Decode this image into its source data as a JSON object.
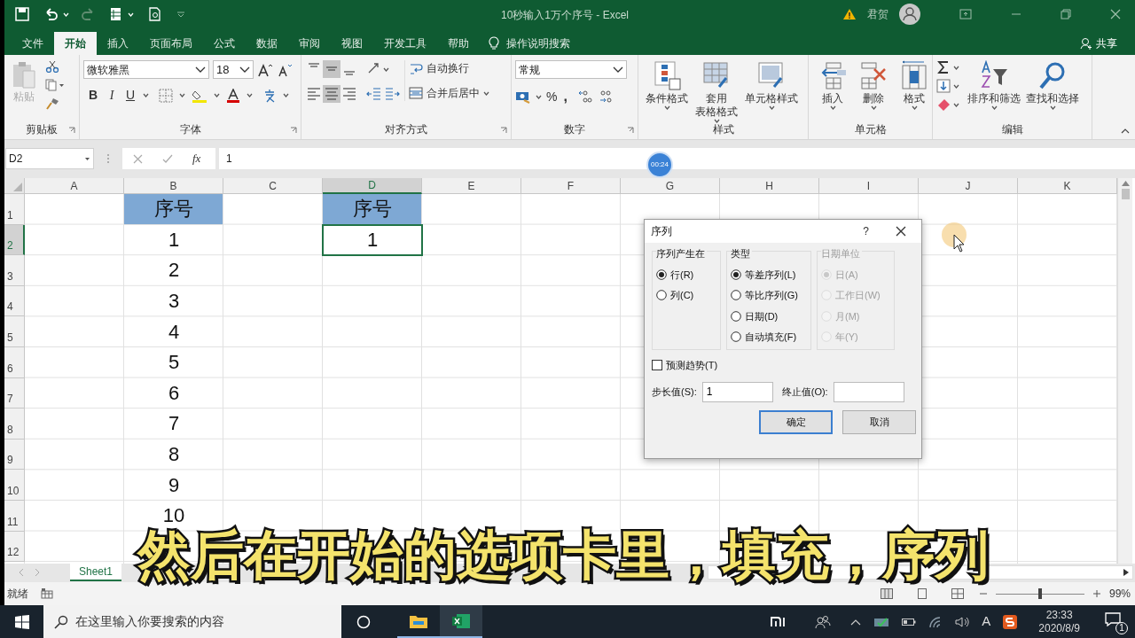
{
  "title_bar": {
    "title": "10秒输入1万个序号 - Excel",
    "user": "君贺"
  },
  "ribbon_tabs": [
    {
      "label": "文件",
      "selected": false
    },
    {
      "label": "开始",
      "selected": true
    },
    {
      "label": "插入",
      "selected": false
    },
    {
      "label": "页面布局",
      "selected": false
    },
    {
      "label": "公式",
      "selected": false
    },
    {
      "label": "数据",
      "selected": false
    },
    {
      "label": "审阅",
      "selected": false
    },
    {
      "label": "视图",
      "selected": false
    },
    {
      "label": "开发工具",
      "selected": false
    },
    {
      "label": "帮助",
      "selected": false
    }
  ],
  "tell_me": "操作说明搜索",
  "share": "共享",
  "ribbon": {
    "clipboard": {
      "label": "剪贴板",
      "paste": "粘贴"
    },
    "font": {
      "label": "字体",
      "font_name": "微软雅黑",
      "font_size": "18",
      "bold": "B",
      "italic": "I",
      "underline": "U"
    },
    "alignment": {
      "label": "对齐方式",
      "wrap_text": "自动换行",
      "merge_center": "合并后居中"
    },
    "number": {
      "label": "数字",
      "format": "常规",
      "percent": "%",
      "comma": ","
    },
    "styles": {
      "label": "样式",
      "buttons": [
        {
          "lines": [
            "条件格式"
          ]
        },
        {
          "lines": [
            "套用",
            "表格格式"
          ]
        },
        {
          "lines": [
            "单元格样式"
          ]
        }
      ]
    },
    "cells": {
      "label": "单元格",
      "buttons": [
        "插入",
        "删除",
        "格式"
      ]
    },
    "editing": {
      "label": "编辑",
      "buttons": [
        "排序和筛选",
        "查找和选择"
      ]
    }
  },
  "formula_bar": {
    "name_box": "D2",
    "fx": "fx",
    "value": "1"
  },
  "timestamp": "00:24",
  "columns": [
    {
      "label": "A",
      "selected": false
    },
    {
      "label": "B",
      "selected": false,
      "cells": [
        {
          "text": "序号",
          "kind": "header",
          "selected": false
        },
        {
          "text": "1",
          "kind": "value",
          "selected": false
        },
        {
          "text": "2",
          "kind": "value",
          "selected": false
        },
        {
          "text": "3",
          "kind": "value",
          "selected": false
        },
        {
          "text": "4",
          "kind": "value",
          "selected": false
        },
        {
          "text": "5",
          "kind": "value",
          "selected": false
        },
        {
          "text": "6",
          "kind": "value",
          "selected": false
        },
        {
          "text": "7",
          "kind": "value",
          "selected": false
        },
        {
          "text": "8",
          "kind": "value",
          "selected": false
        },
        {
          "text": "9",
          "kind": "value",
          "selected": false
        },
        {
          "text": "10",
          "kind": "value",
          "selected": false
        }
      ]
    },
    {
      "label": "C",
      "selected": false
    },
    {
      "label": "D",
      "selected": true,
      "cells": [
        {
          "text": "序号",
          "kind": "header",
          "selected": false
        },
        {
          "text": "1",
          "kind": "value",
          "selected": true
        }
      ]
    },
    {
      "label": "E",
      "selected": false
    },
    {
      "label": "F",
      "selected": false
    },
    {
      "label": "G",
      "selected": false
    },
    {
      "label": "H",
      "selected": false
    },
    {
      "label": "I",
      "selected": false
    },
    {
      "label": "J",
      "selected": false
    },
    {
      "label": "K",
      "selected": false
    }
  ],
  "rows": [
    {
      "label": "1",
      "selected": false
    },
    {
      "label": "2",
      "selected": true
    },
    {
      "label": "3",
      "selected": false
    },
    {
      "label": "4",
      "selected": false
    },
    {
      "label": "5",
      "selected": false
    },
    {
      "label": "6",
      "selected": false
    },
    {
      "label": "7",
      "selected": false
    },
    {
      "label": "8",
      "selected": false
    },
    {
      "label": "9",
      "selected": false
    },
    {
      "label": "10",
      "selected": false
    },
    {
      "label": "11",
      "selected": false
    },
    {
      "label": "12",
      "selected": false
    }
  ],
  "dialog": {
    "title": "序列",
    "help": "?",
    "groups": [
      {
        "label": "序列产生在",
        "disabled": false,
        "options": [
          {
            "label": "行(R)",
            "selected": true
          },
          {
            "label": "列(C)",
            "selected": false
          }
        ]
      },
      {
        "label": "类型",
        "disabled": false,
        "options": [
          {
            "label": "等差序列(L)",
            "selected": true
          },
          {
            "label": "等比序列(G)",
            "selected": false
          },
          {
            "label": "日期(D)",
            "selected": false
          },
          {
            "label": "自动填充(F)",
            "selected": false
          }
        ]
      },
      {
        "label": "日期单位",
        "disabled": true,
        "options": [
          {
            "label": "日(A)",
            "selected": true
          },
          {
            "label": "工作日(W)",
            "selected": false
          },
          {
            "label": "月(M)",
            "selected": false
          },
          {
            "label": "年(Y)",
            "selected": false
          }
        ]
      }
    ],
    "trend": {
      "label": "预测趋势(T)",
      "checked": false
    },
    "step": {
      "label": "步长值(S):",
      "value": "1"
    },
    "stop": {
      "label": "终止值(O):"
    },
    "ok": "确定",
    "cancel": "取消"
  },
  "subtitle": "然后在开始的选项卡里，填充，序列",
  "sheet_tabs": [
    {
      "label": "Sheet1",
      "selected": true
    }
  ],
  "status_bar": {
    "status": "就绪",
    "zoom": "99%"
  },
  "taskbar": {
    "search_placeholder": "在这里输入你要搜索的内容",
    "ime": "A",
    "time": "23:33",
    "date": "2020/8/9",
    "notifications": "1"
  }
}
